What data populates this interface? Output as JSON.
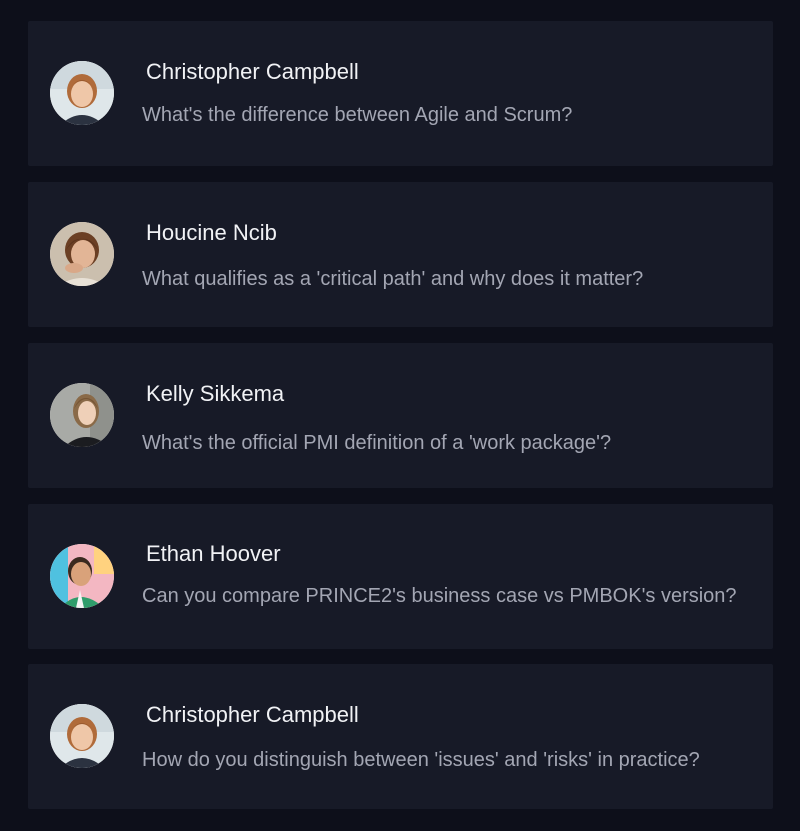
{
  "conversations": [
    {
      "name": "Christopher Campbell",
      "question": "What's the difference between Agile and Scrum?",
      "avatar_icon": "woman-portrait-light-background",
      "accent": "#b06b3a"
    },
    {
      "name": "Houcine Ncib",
      "question": "What qualifies as a 'critical path' and why does it matter?",
      "avatar_icon": "person-portrait-beige-background",
      "accent": "#6b3f24"
    },
    {
      "name": "Kelly Sikkema",
      "question": "What's the official PMI definition of a 'work package'?",
      "avatar_icon": "woman-portrait-grey-background",
      "accent": "#8a6a48"
    },
    {
      "name": "Ethan Hoover",
      "question": "Can you compare PRINCE2's business case vs PMBOK's version?",
      "avatar_icon": "man-portrait-colorful-background",
      "accent": "#2f9d6b"
    },
    {
      "name": "Christopher Campbell",
      "question": "How do you distinguish between 'issues' and 'risks' in practice?",
      "avatar_icon": "woman-portrait-light-background",
      "accent": "#b06b3a"
    }
  ]
}
